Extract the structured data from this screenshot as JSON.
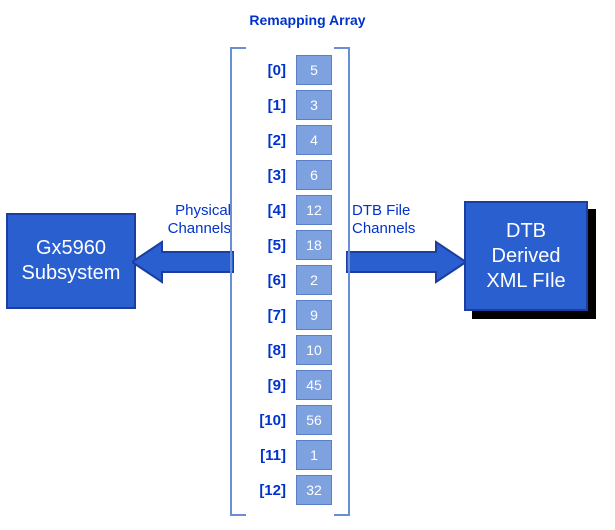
{
  "title": "Remapping Array",
  "left_box": {
    "line1": "Gx5960",
    "line2": "Subsystem"
  },
  "right_box": {
    "line1": "DTB",
    "line2": "Derived",
    "line3": "XML FIle"
  },
  "left_label": {
    "line1": "Physical",
    "line2": "Channels"
  },
  "right_label": {
    "line1": "DTB File",
    "line2": "Channels"
  },
  "rows": [
    {
      "idx": "[0]",
      "val": "5"
    },
    {
      "idx": "[1]",
      "val": "3"
    },
    {
      "idx": "[2]",
      "val": "4"
    },
    {
      "idx": "[3]",
      "val": "6"
    },
    {
      "idx": "[4]",
      "val": "12"
    },
    {
      "idx": "[5]",
      "val": "18"
    },
    {
      "idx": "[6]",
      "val": "2"
    },
    {
      "idx": "[7]",
      "val": "9"
    },
    {
      "idx": "[8]",
      "val": "10"
    },
    {
      "idx": "[9]",
      "val": "45"
    },
    {
      "idx": "[10]",
      "val": "56"
    },
    {
      "idx": "[11]",
      "val": "1"
    },
    {
      "idx": "[12]",
      "val": "32"
    }
  ],
  "chart_data": {
    "type": "table",
    "title": "Remapping Array",
    "columns": [
      "Physical Channel Index",
      "DTB File Channel"
    ],
    "rows": [
      [
        0,
        5
      ],
      [
        1,
        3
      ],
      [
        2,
        4
      ],
      [
        3,
        6
      ],
      [
        4,
        12
      ],
      [
        5,
        18
      ],
      [
        6,
        2
      ],
      [
        7,
        9
      ],
      [
        8,
        10
      ],
      [
        9,
        45
      ],
      [
        10,
        56
      ],
      [
        11,
        1
      ],
      [
        12,
        32
      ]
    ],
    "left_entity": "Gx5960 Subsystem",
    "right_entity": "DTB Derived XML FIle"
  }
}
